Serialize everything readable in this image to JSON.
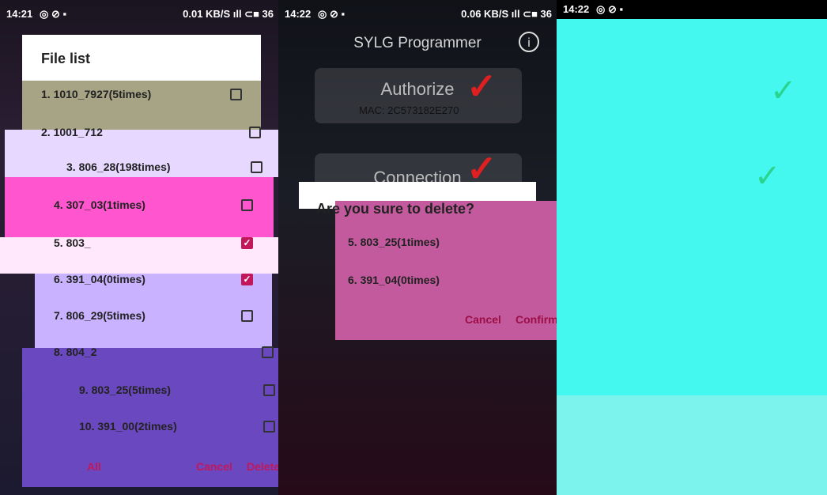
{
  "panel1": {
    "status": {
      "time": "14:21",
      "icons_left": "◎ ⊘ ▪",
      "icons_right": "0.01 KB/S  ıll  ⊂■ 36"
    },
    "dialog": {
      "title": "File list",
      "items": [
        {
          "label": "1. 1010_7927(5times)",
          "checked": false
        },
        {
          "label": "2. 1001_712",
          "checked": false
        },
        {
          "label": "3. 806_28(198times)",
          "checked": false
        },
        {
          "label": "4. 307_03(1times)",
          "checked": false
        },
        {
          "label": "5. 803_",
          "checked": true
        },
        {
          "label": "6. 391_04(0times)",
          "checked": true
        },
        {
          "label": "7. 806_29(5times)",
          "checked": false
        },
        {
          "label": "8. 804_2",
          "checked": false
        },
        {
          "label": "9. 803_25(5times)",
          "checked": false
        },
        {
          "label": "10. 391_00(2times)",
          "checked": false
        }
      ],
      "all_label": "All",
      "cancel_label": "Cancel",
      "delete_label": "Delete"
    }
  },
  "panel2": {
    "status": {
      "time": "14:22",
      "icons_left": "◎ ⊘ ▪",
      "icons_right": "0.06 KB/S  ıll  ⊂■ 36"
    },
    "app_title": "SYLG Programmer",
    "info_icon": "i",
    "authorize_label": "Authorize",
    "mac_text": "MAC: 2C573182E270",
    "connection_label": "Connection",
    "confirm": {
      "title": "Are you sure to delete?",
      "items": [
        "5. 803_25(1times)",
        "6. 391_04(0times)"
      ],
      "cancel_label": "Cancel",
      "confirm_label": "Confirm"
    }
  },
  "panel3": {
    "status": {
      "time": "14:22",
      "icons_left": "◎ ⊘ ▪"
    }
  },
  "colors": {
    "accent": "#c2185b",
    "dialog_pink": "#c45a9e",
    "panel3_bg": "#44f7ef"
  }
}
